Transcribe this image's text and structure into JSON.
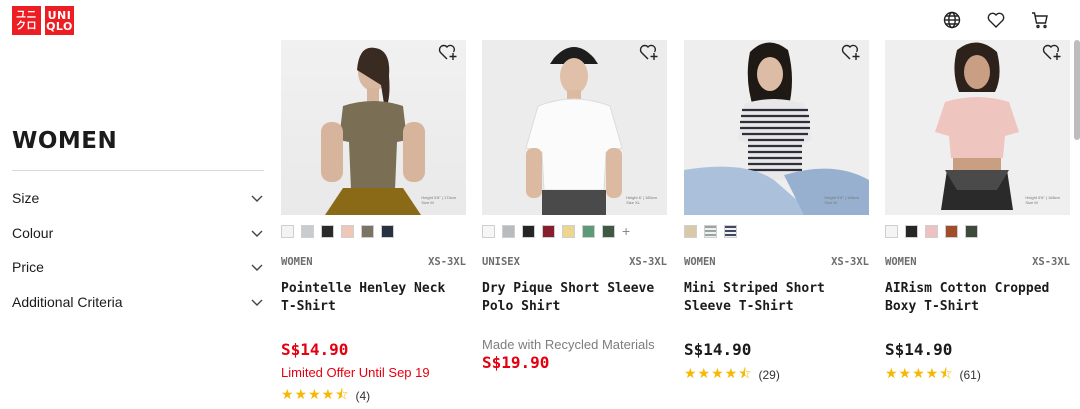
{
  "brand": {
    "tile1": "ユニ\nクロ",
    "tile2": "UNI\nQLO"
  },
  "header": {
    "icons": [
      "globe-icon",
      "heart-icon",
      "cart-icon"
    ]
  },
  "sidebar": {
    "title": "WOMEN",
    "filters": [
      "Size",
      "Colour",
      "Price",
      "Additional Criteria"
    ]
  },
  "products": [
    {
      "gender": "WOMEN",
      "sizes": "XS-3XL",
      "name": "Pointelle Henley Neck T-Shirt",
      "price": "S$14.90",
      "price_style": "sale",
      "promo": "Limited Offer Until Sep 19",
      "rating_stars": 4.5,
      "review_count": "(4)",
      "swatches": [
        "#f3f3f3",
        "#c9ccce",
        "#2a2a2a",
        "#efc7b9",
        "#7a7462",
        "#283042"
      ]
    },
    {
      "gender": "UNISEX",
      "sizes": "XS-3XL",
      "name": "Dry Pique Short Sleeve Polo Shirt",
      "price": "S$19.90",
      "price_style": "sale",
      "note": "Made with Recycled Materials",
      "swatches": [
        "#f6f6f6",
        "#b9bcbf",
        "#252525",
        "#8a1d2b",
        "#ecd68d",
        "#5c9a78",
        "#3f5a43"
      ],
      "more": "+"
    },
    {
      "gender": "WOMEN",
      "sizes": "XS-3XL",
      "name": "Mini Striped Short Sleeve T-Shirt",
      "price": "S$14.90",
      "price_style": "regular",
      "rating_stars": 4.5,
      "review_count": "(29)",
      "swatches": [
        "#d9c9a9",
        "#7f8c88",
        "#3f4a62"
      ]
    },
    {
      "gender": "WOMEN",
      "sizes": "XS-3XL",
      "name": "AIRism Cotton Cropped Boxy T-Shirt",
      "price": "S$14.90",
      "price_style": "regular",
      "rating_stars": 4.5,
      "review_count": "(61)",
      "swatches": [
        "#f4f4f4",
        "#262626",
        "#efc2c2",
        "#a24d2a",
        "#3e4a3a"
      ]
    }
  ],
  "photo_notes": [
    "Height 5'8\" | 174cm\nSize M",
    "Height 6' | 183cm\nSize XL",
    "Height 5'6\" | 168cm\nSize M",
    "Height 5'6\" | 168cm\nSize M"
  ],
  "colors": {
    "brand_red": "#ed1d24",
    "sale_red": "#e50010",
    "star": "#f6b800"
  }
}
